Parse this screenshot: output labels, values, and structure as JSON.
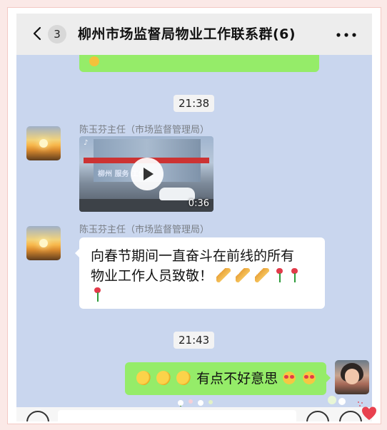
{
  "header": {
    "unread_count": "3",
    "title": "柳州市场监督局物业工作联系群(6)"
  },
  "messages": {
    "time_1": "21:38",
    "msg_1": {
      "sender": "陈玉芬主任（市场监督管理局）",
      "video_duration": "0:36",
      "video_mark": "♪",
      "video_caption": "柳州 服务 工作"
    },
    "msg_2": {
      "sender": "陈玉芬主任（市场监督管理局）",
      "line_1": "向春节期间一直奋斗在前线的所有",
      "line_2": "物业工作人员致敬！"
    },
    "time_2": "21:43",
    "msg_3": {
      "text": "有点不好意思"
    }
  },
  "colors": {
    "chat_background": "#c9d6ee",
    "own_bubble": "#95ec69",
    "header_background": "#ededed",
    "frame_background": "#fbe9e7"
  },
  "icons": [
    "back-icon",
    "more-icon",
    "play-icon",
    "voice-icon",
    "emoji-icon",
    "plus-icon",
    "heart-icon"
  ]
}
